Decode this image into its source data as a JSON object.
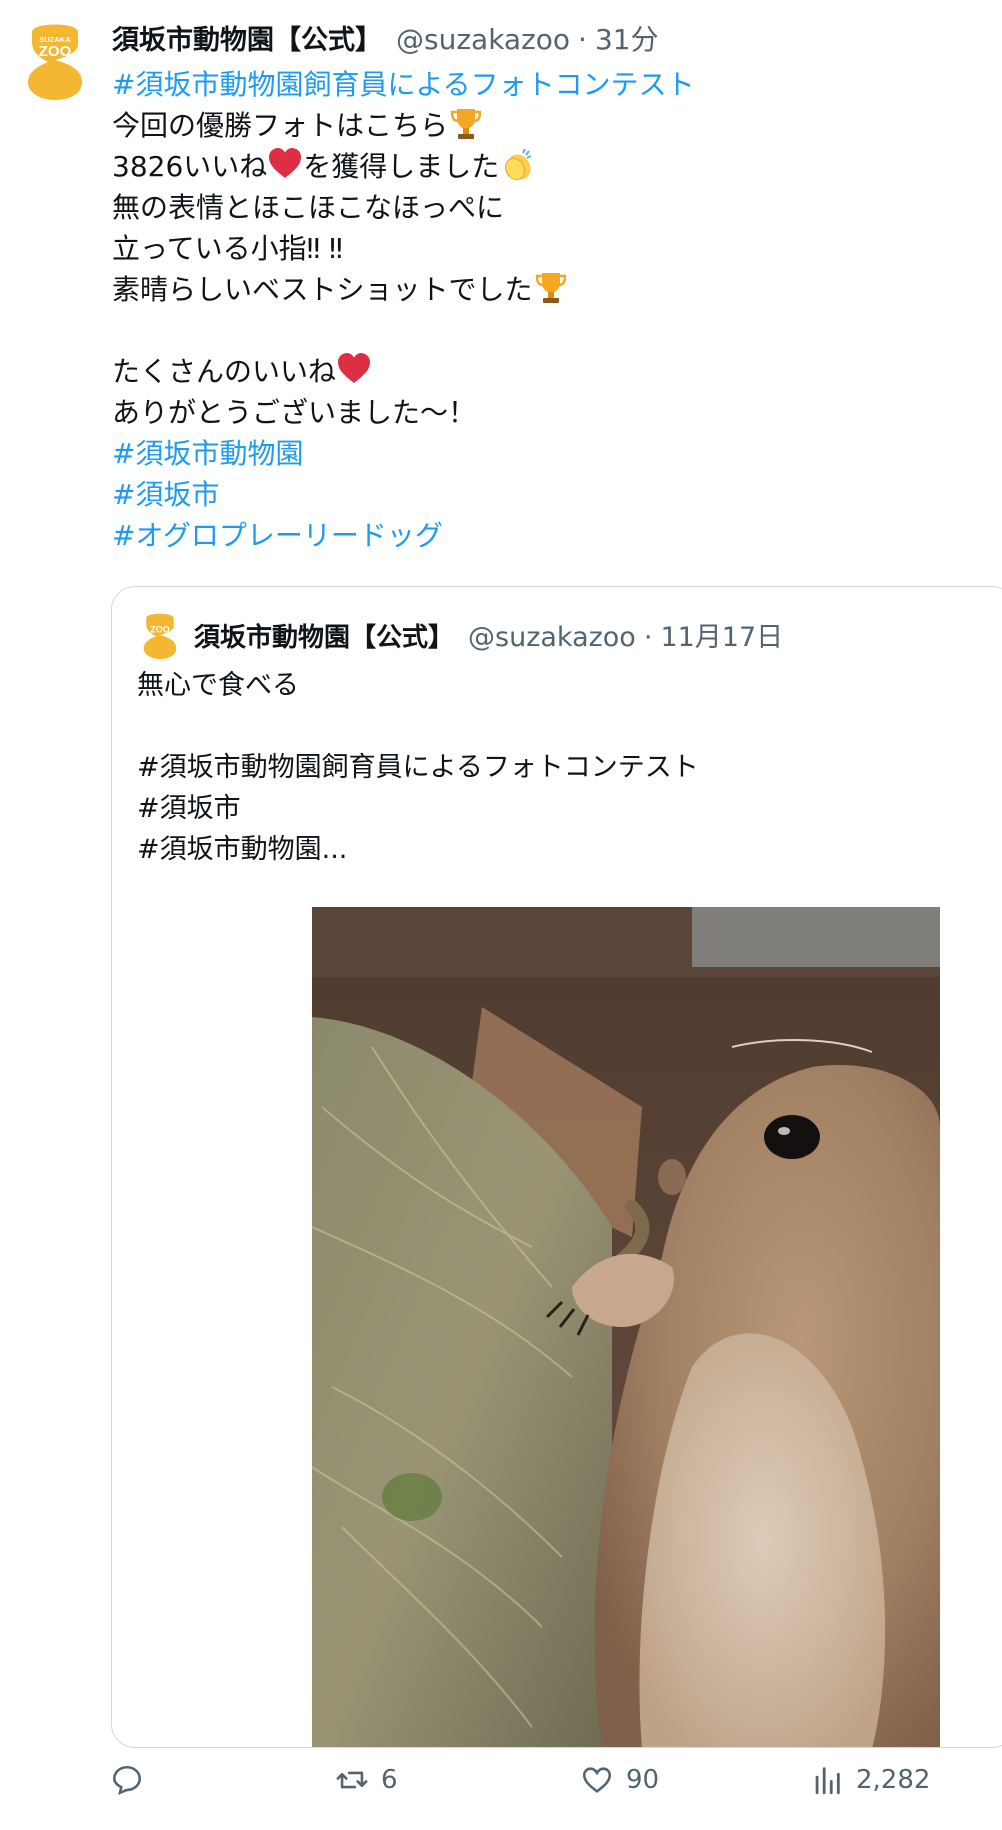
{
  "tweet": {
    "author_name": "須坂市動物園【公式】",
    "handle": "@suzakazoo",
    "separator": "·",
    "time": "31分",
    "avatar_text_top": "SUZAKA",
    "avatar_text_main": "ZOO",
    "avatar_color": "#f4b731",
    "lines": [
      {
        "text": "#須坂市動物園飼育員によるフォトコンテスト",
        "type": "hashtag"
      },
      {
        "text": "今回の優勝フォトはこちら",
        "type": "text",
        "emoji": "trophy-icon"
      },
      {
        "text": "3826いいね",
        "type": "text",
        "emoji": "heart-icon",
        "after": "を獲得しました",
        "emoji2": "clap-icon"
      },
      {
        "text": "無の表情とほこほこなほっぺに",
        "type": "text"
      },
      {
        "text": "立っている小指‼︎ ‼︎",
        "type": "text"
      },
      {
        "text": "素晴らしいベストショットでした",
        "type": "text",
        "emoji": "trophy-icon"
      },
      {
        "text": "",
        "type": "blank"
      },
      {
        "text": "たくさんのいいね",
        "type": "text",
        "emoji": "heart-icon"
      },
      {
        "text": "ありがとうございました〜！",
        "type": "text"
      },
      {
        "text": "#須坂市動物園",
        "type": "hashtag"
      },
      {
        "text": "#須坂市",
        "type": "hashtag"
      },
      {
        "text": "#オグロプレーリードッグ",
        "type": "hashtag"
      }
    ]
  },
  "quoted": {
    "author_name": "須坂市動物園【公式】",
    "handle": "@suzakazoo",
    "separator": "·",
    "time": "11月17日",
    "lines": [
      {
        "text": "無心で食べる",
        "type": "text"
      },
      {
        "text": "",
        "type": "blank"
      },
      {
        "text": "#須坂市動物園飼育員によるフォトコンテスト",
        "type": "text"
      },
      {
        "text": "#須坂市",
        "type": "text"
      },
      {
        "text": "#須坂市動物園...",
        "type": "text"
      }
    ],
    "photo_subject": "prairie-dog-eating-hay-photo"
  },
  "actions": {
    "reply_count": "",
    "retweet_count": "6",
    "like_count": "90",
    "views_count": "2,282"
  },
  "colors": {
    "link": "#1d9bf0",
    "text": "#0f1419",
    "muted": "#536471",
    "border": "#cfd9de",
    "retweet_icon": "#536471"
  }
}
